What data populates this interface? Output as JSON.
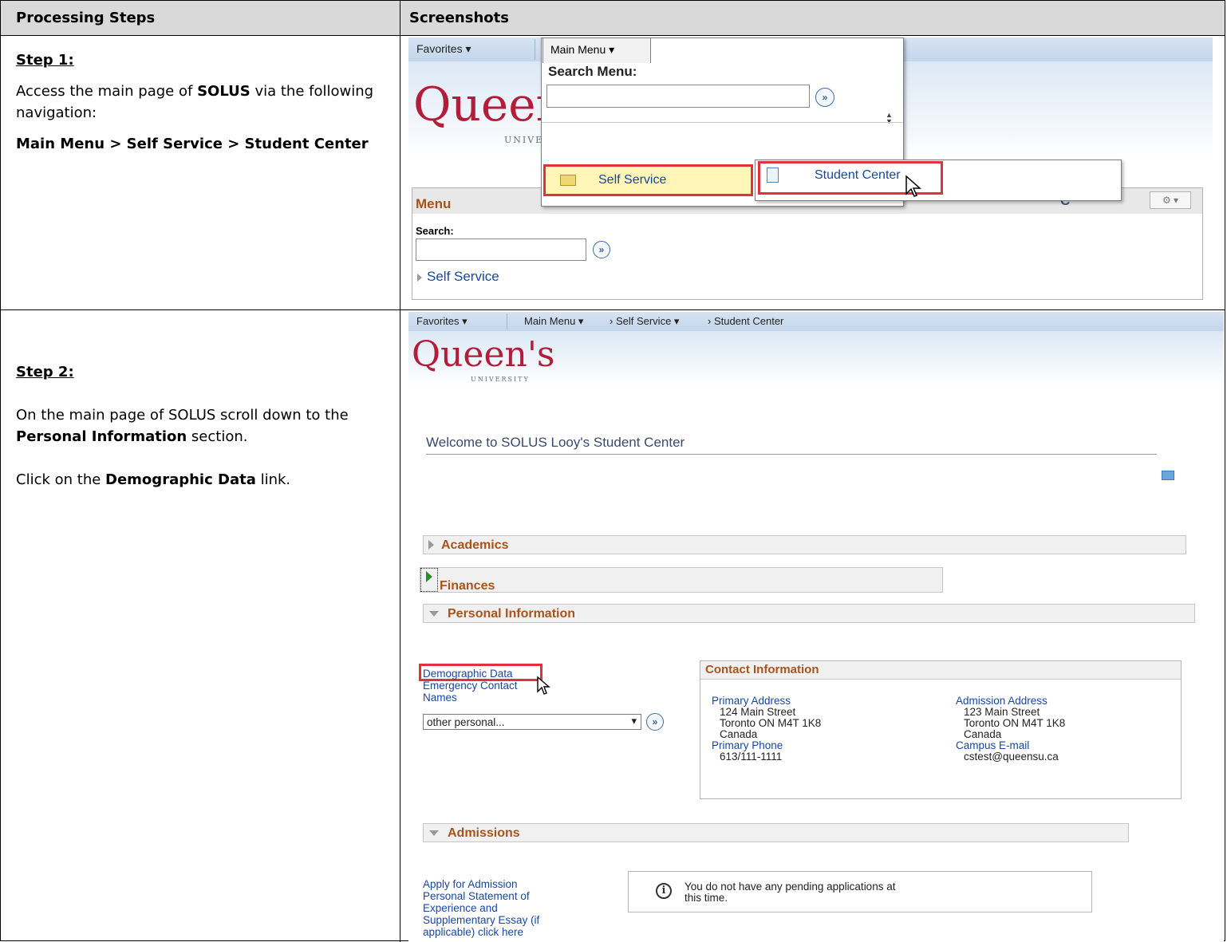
{
  "table": {
    "col1_header": "Processing Steps",
    "col2_header": "Screenshots"
  },
  "step1": {
    "title": "Step 1:",
    "text_a": "Access the main page of ",
    "text_b": "SOLUS",
    "text_c": " via the following navigation:",
    "nav_path": "Main Menu > Self Service > Student Center"
  },
  "step2": {
    "title": "Step 2:",
    "text1_a": "On the main page of SOLUS scroll down to the ",
    "text1_b": "Personal Information",
    "text1_c": " section.",
    "text2_a": "Click on the ",
    "text2_b": "Demographic Data",
    "text2_c": " link."
  },
  "shot1": {
    "favorites": "Favorites ▾",
    "main_menu": "Main Menu ▾",
    "logo": "Queen",
    "logo_sub": "UNIVE",
    "search_menu_label": "Search Menu:",
    "self_service": "Self Service",
    "student_center": "Student Center",
    "menu_title": "Menu",
    "search_label": "Search:",
    "self_service_link": "Self Service",
    "refresh_char": "C",
    "gear": "⚙ ▾"
  },
  "shot2": {
    "nav": {
      "favorites": "Favorites ▾",
      "main_menu": "Main Menu ▾",
      "crumb1": "› Self Service ▾",
      "crumb2": "› Student Center"
    },
    "logo": "Queen's",
    "logo_sub": "UNIVERSITY",
    "welcome": "Welcome to SOLUS Looy's Student Center",
    "sections": {
      "academics": "Academics",
      "finances": "Finances",
      "personal": "Personal Information",
      "admissions": "Admissions"
    },
    "personal_links": [
      "Demographic Data",
      "Emergency Contact",
      "Names"
    ],
    "personal_select": "other personal...",
    "contact": {
      "title": "Contact Information",
      "primary_address_label": "Primary Address",
      "primary_address": [
        "124 Main Street",
        "Toronto ON M4T 1K8",
        "Canada"
      ],
      "primary_phone_label": "Primary Phone",
      "primary_phone": "613/111-1111",
      "admission_address_label": "Admission Address",
      "admission_address": [
        "123 Main Street",
        "Toronto ON M4T 1K8",
        "Canada"
      ],
      "campus_email_label": "Campus E-mail",
      "campus_email": "cstest@queensu.ca"
    },
    "admissions_links": [
      "Apply for Admission",
      "Personal Statement of",
      "Experience and",
      "Supplementary Essay (if",
      "applicable) click here"
    ],
    "pending_msg_1": "You do not have any pending applications at",
    "pending_msg_2": "this time."
  },
  "colors": {
    "header_bg": "#d9d9d9",
    "highlight_red": "#e0313c",
    "link_blue": "#17479e",
    "section_orange": "#a8541b",
    "brand_red": "#b21e3a"
  }
}
